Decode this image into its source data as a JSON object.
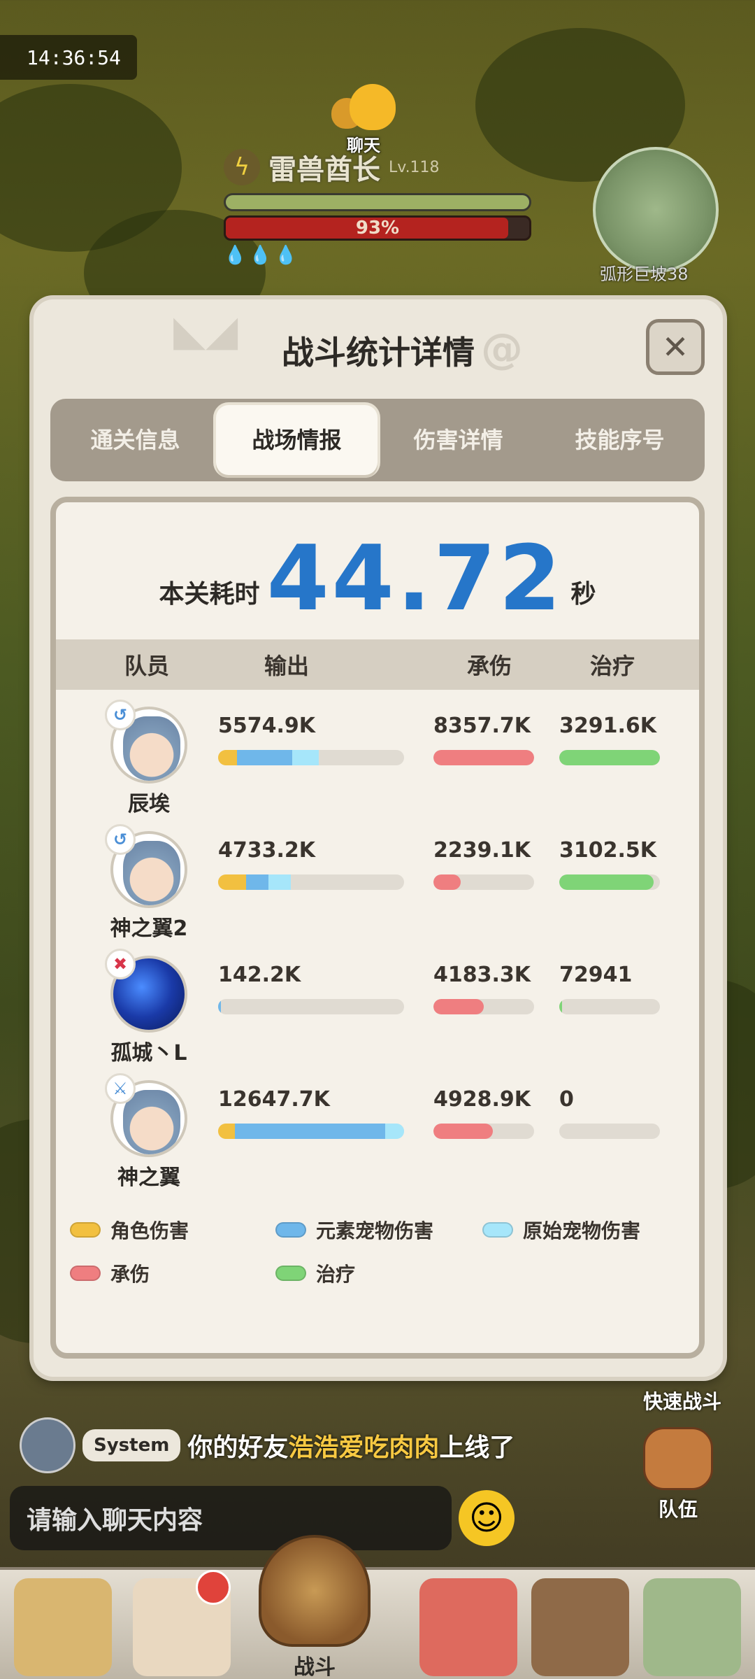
{
  "status": {
    "clock": "14:36:54"
  },
  "top": {
    "chat_label": "聊天",
    "boss_name": "雷兽酋长",
    "boss_level": "Lv.118",
    "boss_hp_pct_text": "93%",
    "boss_hp_fraction": 0.93,
    "drops": "💧💧💧",
    "minimap_label": "弧形巨坡38"
  },
  "dialog": {
    "title": "战斗统计详情",
    "close_icon": "✕",
    "tabs": [
      {
        "label": "通关信息"
      },
      {
        "label": "战场情报"
      },
      {
        "label": "伤害详情"
      },
      {
        "label": "技能序号"
      }
    ],
    "time_label": "本关耗时",
    "time_value": "44.72",
    "time_unit": "秒",
    "columns": [
      "队员",
      "输出",
      "承伤",
      "治疗"
    ],
    "members": [
      {
        "name": "辰埃",
        "badge_icon": "element-icon",
        "badge_glyph": "↺",
        "badge_color": "#4b8fd6",
        "output": "5574.9K",
        "tank": "8357.7K",
        "heal": "3291.6K",
        "output_segments": [
          0.1,
          0.3,
          0.14
        ],
        "tank_fraction": 1.0,
        "heal_fraction": 1.0
      },
      {
        "name": "神之翼2",
        "badge_icon": "element-icon",
        "badge_glyph": "↺",
        "badge_color": "#4b8fd6",
        "output": "4733.2K",
        "tank": "2239.1K",
        "heal": "3102.5K",
        "output_segments": [
          0.15,
          0.12,
          0.12
        ],
        "tank_fraction": 0.27,
        "heal_fraction": 0.94
      },
      {
        "name": "孤城丶L",
        "badge_icon": "attack-icon",
        "badge_glyph": "✖",
        "badge_color": "#d8354a",
        "output": "142.2K",
        "tank": "4183.3K",
        "heal": "72941",
        "output_segments": [
          0.0,
          0.012,
          0.0
        ],
        "tank_fraction": 0.5,
        "heal_fraction": 0.02
      },
      {
        "name": "神之翼",
        "badge_icon": "sword-icon",
        "badge_glyph": "⚔",
        "badge_color": "#4b8fd6",
        "output": "12647.7K",
        "tank": "4928.9K",
        "heal": "0",
        "output_segments": [
          0.09,
          0.81,
          0.1
        ],
        "tank_fraction": 0.59,
        "heal_fraction": 0.0
      }
    ],
    "legend": [
      {
        "label": "角色伤害",
        "color": "#f2c040"
      },
      {
        "label": "元素宠物伤害",
        "color": "#6fb7ea"
      },
      {
        "label": "原始宠物伤害",
        "color": "#a6e6fa"
      },
      {
        "label": "承伤",
        "color": "#ef7e80"
      },
      {
        "label": "治疗",
        "color": "#7fd477"
      }
    ]
  },
  "chat": {
    "system_tag": "System",
    "message_prefix": "你的好友",
    "message_friend": "浩浩爱吃肉肉",
    "message_suffix": "上线了",
    "input_placeholder": "请输入聊天内容"
  },
  "side": {
    "quick_battle": "快速战斗",
    "team": "队伍"
  },
  "nav": {
    "battle_label": "战斗"
  }
}
